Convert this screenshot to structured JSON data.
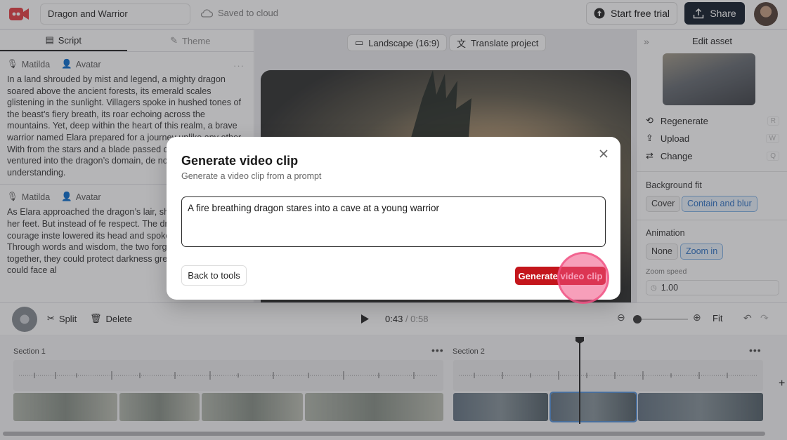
{
  "topbar": {
    "project_name": "Dragon and Warrior",
    "save_status": "Saved to cloud",
    "trial_label": "Start free trial",
    "share_label": "Share"
  },
  "left": {
    "tabs": [
      {
        "label": "Script"
      },
      {
        "label": "Theme"
      }
    ],
    "blocks": [
      {
        "voice": "Matilda",
        "avatar": "Avatar",
        "text": "In a land shrouded by mist and legend, a mighty dragon soared above the ancient forests, its emerald scales glistening in the sunlight. Villagers spoke in hushed tones of the beast’s fiery breath, its roar echoing across the mountains. Yet, deep within the heart of this realm, a brave warrior named Elara prepared for a journey unlike any other. With from the stars and a blade passed down th she ventured into the dragon’s domain, de not vengeance, but understanding."
      },
      {
        "voice": "Matilda",
        "avatar": "Avatar",
        "text": "As Elara approached the dragon’s lair, she tremble beneath her feet. But instead of fe respect. The dragon, seeing courage inste lowered its head and spoke in a voice as o Through words and wisdom, the two forge realizing that together, they could protect darkness greater than either could face al"
      }
    ]
  },
  "center": {
    "aspect_label": "Landscape (16:9)",
    "translate_label": "Translate project"
  },
  "right": {
    "title": "Edit asset",
    "actions": [
      {
        "label": "Regenerate",
        "key": "R"
      },
      {
        "label": "Upload",
        "key": "W"
      },
      {
        "label": "Change",
        "key": "Q"
      }
    ],
    "bg_fit_label": "Background fit",
    "bg_fit_options": [
      "Cover",
      "Contain and blur"
    ],
    "animation_label": "Animation",
    "animation_options": [
      "None",
      "Zoom in"
    ],
    "zoom_speed_label": "Zoom speed",
    "zoom_speed_value": "1.00"
  },
  "controls": {
    "split_label": "Split",
    "delete_label": "Delete",
    "current_time": "0:43",
    "total_time": "/ 0:58",
    "fit_label": "Fit"
  },
  "timeline": {
    "section1": "Section 1",
    "section2": "Section 2",
    "dots": "•••"
  },
  "modal": {
    "title": "Generate video clip",
    "subtitle": "Generate a video clip from a prompt",
    "prompt": "A fire breathing dragon stares into a cave at a young warrior",
    "back_label": "Back to tools",
    "generate_label": "Generate video clip"
  },
  "colors": {
    "brand_red": "#c4161c",
    "share_dark": "#1f2a37",
    "selected_blue": "#3b7bc8"
  }
}
